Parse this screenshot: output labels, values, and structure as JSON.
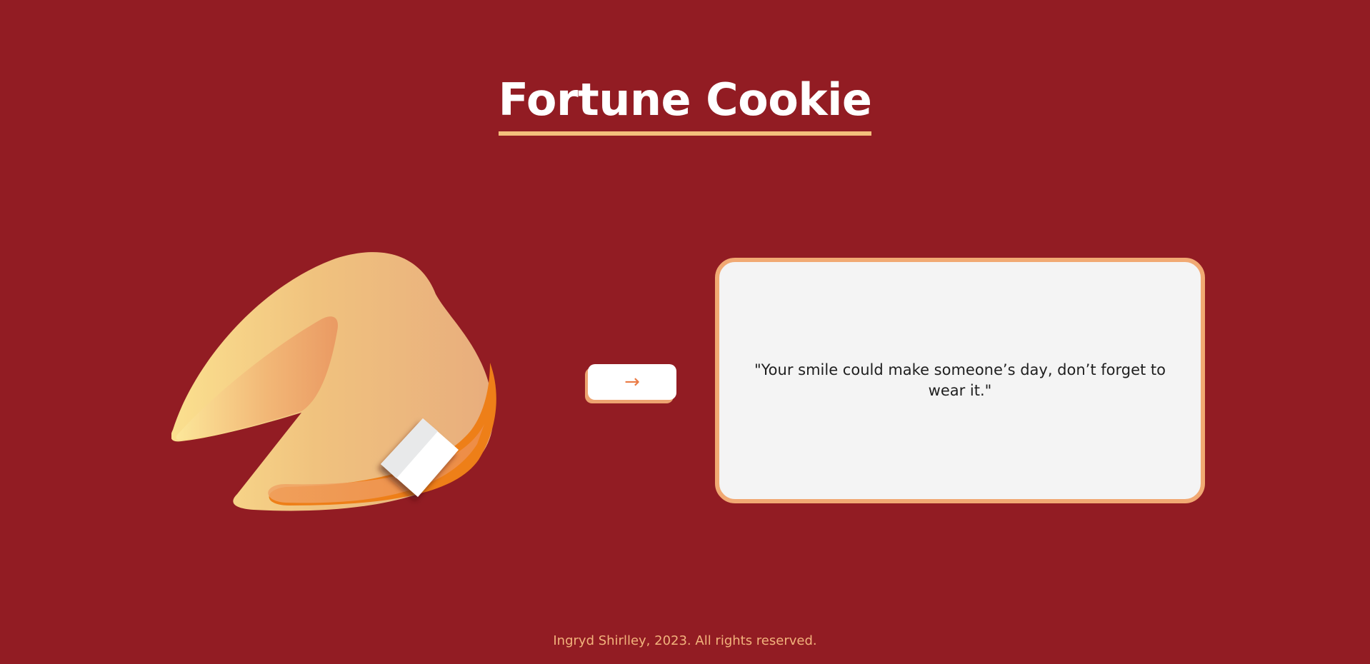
{
  "header": {
    "title": "Fortune Cookie"
  },
  "controls": {
    "next_label": "→"
  },
  "fortune": {
    "text": "\"Your smile could make someone’s day, don’t forget to wear it.\""
  },
  "footer": {
    "text": "Ingryd Shirlley, 2023. All rights reserved."
  },
  "colors": {
    "background": "#921c23",
    "title_underline": "#f4bf7c",
    "card_border": "#f1a973",
    "card_background": "#f4f4f4",
    "button_accent": "#ea7b45",
    "footer_text": "#f2b37c"
  },
  "icons": {
    "illustration": "fortune-cookie-illustration",
    "next": "right-arrow-icon"
  }
}
